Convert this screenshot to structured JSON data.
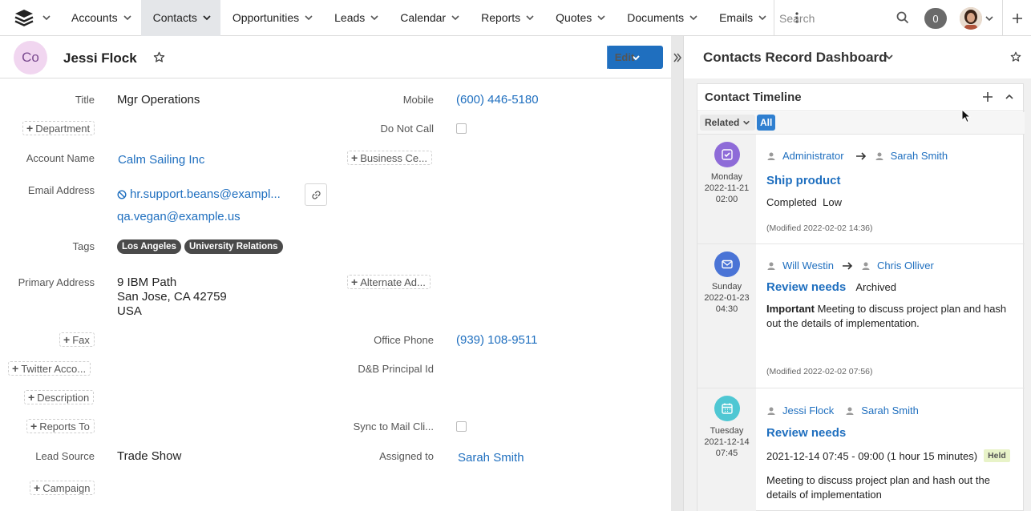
{
  "nav": {
    "tabs": [
      {
        "label": "Accounts"
      },
      {
        "label": "Contacts"
      },
      {
        "label": "Opportunities"
      },
      {
        "label": "Leads"
      },
      {
        "label": "Calendar"
      },
      {
        "label": "Reports"
      },
      {
        "label": "Quotes"
      },
      {
        "label": "Documents"
      },
      {
        "label": "Emails"
      }
    ],
    "search_placeholder": "Search",
    "notification_count": "0"
  },
  "record": {
    "avatar_initials": "Co",
    "name": "Jessi Flock",
    "edit_label": "Edit"
  },
  "fields": {
    "title_label": "Title",
    "title_value": "Mgr Operations",
    "mobile_label": "Mobile",
    "mobile_value": "(600) 446-5180",
    "department_btn": "Department",
    "do_not_call_label": "Do Not Call",
    "account_name_label": "Account Name",
    "account_name_value": "Calm Sailing Inc",
    "business_center_btn": "Business Ce...",
    "email_label": "Email Address",
    "email_1": "hr.support.beans@exampl...",
    "email_2": "qa.vegan@example.us",
    "tags_label": "Tags",
    "tags": [
      "Los Angeles",
      "University Relations"
    ],
    "primary_address_label": "Primary Address",
    "address_line1": "9 IBM Path",
    "address_line2": "San Jose, CA 42759",
    "address_line3": "USA",
    "alternate_address_btn": "Alternate Ad...",
    "fax_btn": "Fax",
    "office_phone_label": "Office Phone",
    "office_phone_value": "(939) 108-9511",
    "twitter_btn": "Twitter Acco...",
    "dnb_label": "D&B Principal Id",
    "description_btn": "Description",
    "reports_to_btn": "Reports To",
    "sync_label": "Sync to Mail Cli...",
    "lead_source_label": "Lead Source",
    "lead_source_value": "Trade Show",
    "assigned_to_label": "Assigned to",
    "assigned_to_value": "Sarah Smith",
    "campaign_btn": "Campaign"
  },
  "dashboard": {
    "title": "Contacts Record Dashboard",
    "timeline_title": "Contact Timeline",
    "filter_related": "Related",
    "filter_all": "All",
    "entries": [
      {
        "type": "task",
        "icon_color": "#8e6bd8",
        "day": "Monday",
        "date": "2022-11-21",
        "time": "02:00",
        "from": "Administrator",
        "to": "Sarah Smith",
        "title": "Ship product",
        "status": "Completed",
        "priority": "Low",
        "modified": "(Modified 2022-02-02 14:36)"
      },
      {
        "type": "email",
        "icon_color": "#4a74d6",
        "day": "Sunday",
        "date": "2022-01-23",
        "time": "04:30",
        "from": "Will Westin",
        "to": "Chris Olliver",
        "title": "Review needs",
        "status": "Archived",
        "importance": "Important",
        "description": "Meeting to discuss project plan and hash out the details of implementation.",
        "modified": "(Modified 2022-02-02 07:56)"
      },
      {
        "type": "meeting",
        "icon_color": "#4fc7d3",
        "day": "Tuesday",
        "date": "2021-12-14",
        "time": "07:45",
        "from": "Jessi Flock",
        "to": "Sarah Smith",
        "title": "Review needs",
        "range": "2021-12-14 07:45 - 09:00 (1 hour 15 minutes)",
        "badge": "Held",
        "description": "Meeting to discuss project plan and hash out the details of implementation"
      }
    ]
  }
}
